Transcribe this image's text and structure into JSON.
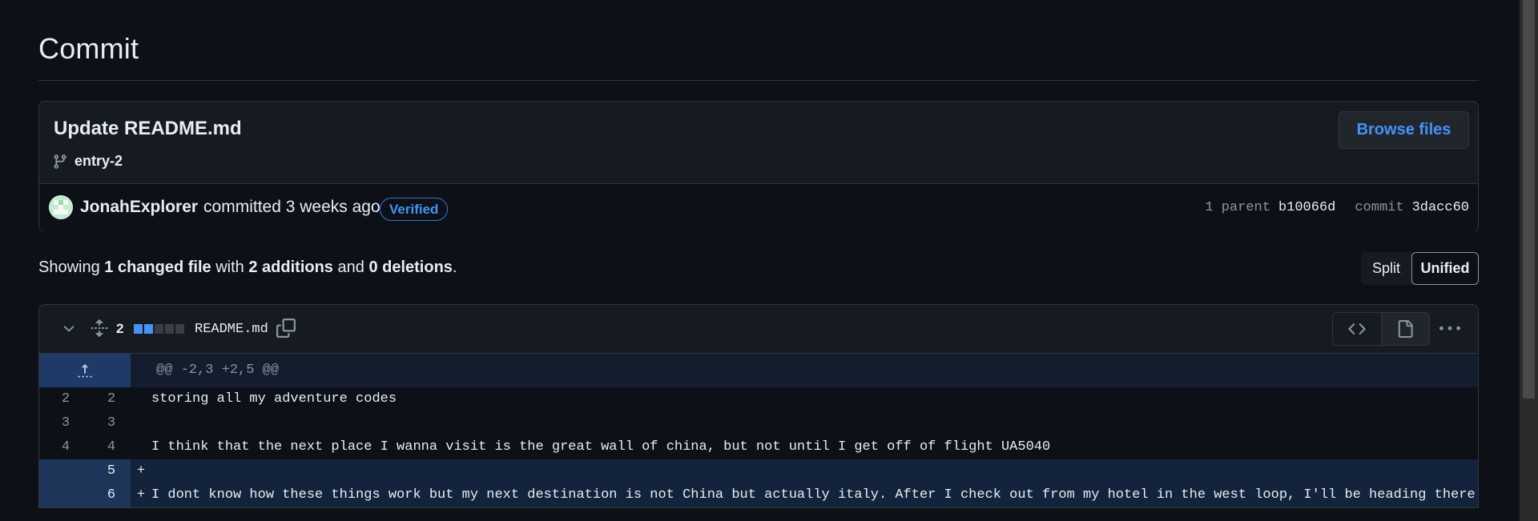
{
  "page_title": "Commit",
  "commit": {
    "message": "Update README.md",
    "branch": "entry-2",
    "browse_label": "Browse files",
    "author": "JonahExplorer",
    "committed_text": "committed 3 weeks ago",
    "verified_label": "Verified",
    "parent_label": "1 parent",
    "parent_sha": "b10066d",
    "commit_label": "commit",
    "commit_sha": "3dacc60"
  },
  "summary": {
    "showing": "Showing",
    "changed": "1 changed file",
    "with": "with",
    "additions": "2 additions",
    "and": "and",
    "deletions": "0 deletions",
    "period": "."
  },
  "view_toggle": {
    "split": "Split",
    "unified": "Unified",
    "selected": "Unified"
  },
  "file": {
    "change_count": "2",
    "filename": "README.md",
    "diffstat": [
      "added",
      "added",
      "neutral",
      "neutral",
      "neutral"
    ]
  },
  "diff": {
    "hunk_header": "@@ -2,3 +2,5 @@",
    "lines": [
      {
        "old": "2",
        "new": "2",
        "sign": "",
        "type": "context",
        "text": "storing all my adventure codes"
      },
      {
        "old": "3",
        "new": "3",
        "sign": "",
        "type": "context",
        "text": ""
      },
      {
        "old": "4",
        "new": "4",
        "sign": "",
        "type": "context",
        "text": "I think that the next place I wanna visit is the great wall of china, but not until I get off of flight UA5040"
      },
      {
        "old": "",
        "new": "5",
        "sign": "+",
        "type": "addition",
        "text": ""
      },
      {
        "old": "",
        "new": "6",
        "sign": "+",
        "type": "addition",
        "text": "I dont know how these things work but my next destination is not China but actually italy. After I check out from my hotel in the west loop, I'll be heading there."
      }
    ]
  },
  "colors": {
    "background": "#0d1117",
    "accent": "#4493f8",
    "addition_bg": "#12233b",
    "addition_gutter": "#1d3559",
    "hunk_gutter": "#1f3a66"
  },
  "icons": {
    "branch": "git-branch-icon",
    "chevron": "chevron-down-icon",
    "expand": "unfold-icon",
    "copy": "copy-icon",
    "code": "code-icon",
    "file": "file-icon",
    "kebab": "kebab-horizontal-icon",
    "hunk_expand": "expand-up-icon"
  }
}
